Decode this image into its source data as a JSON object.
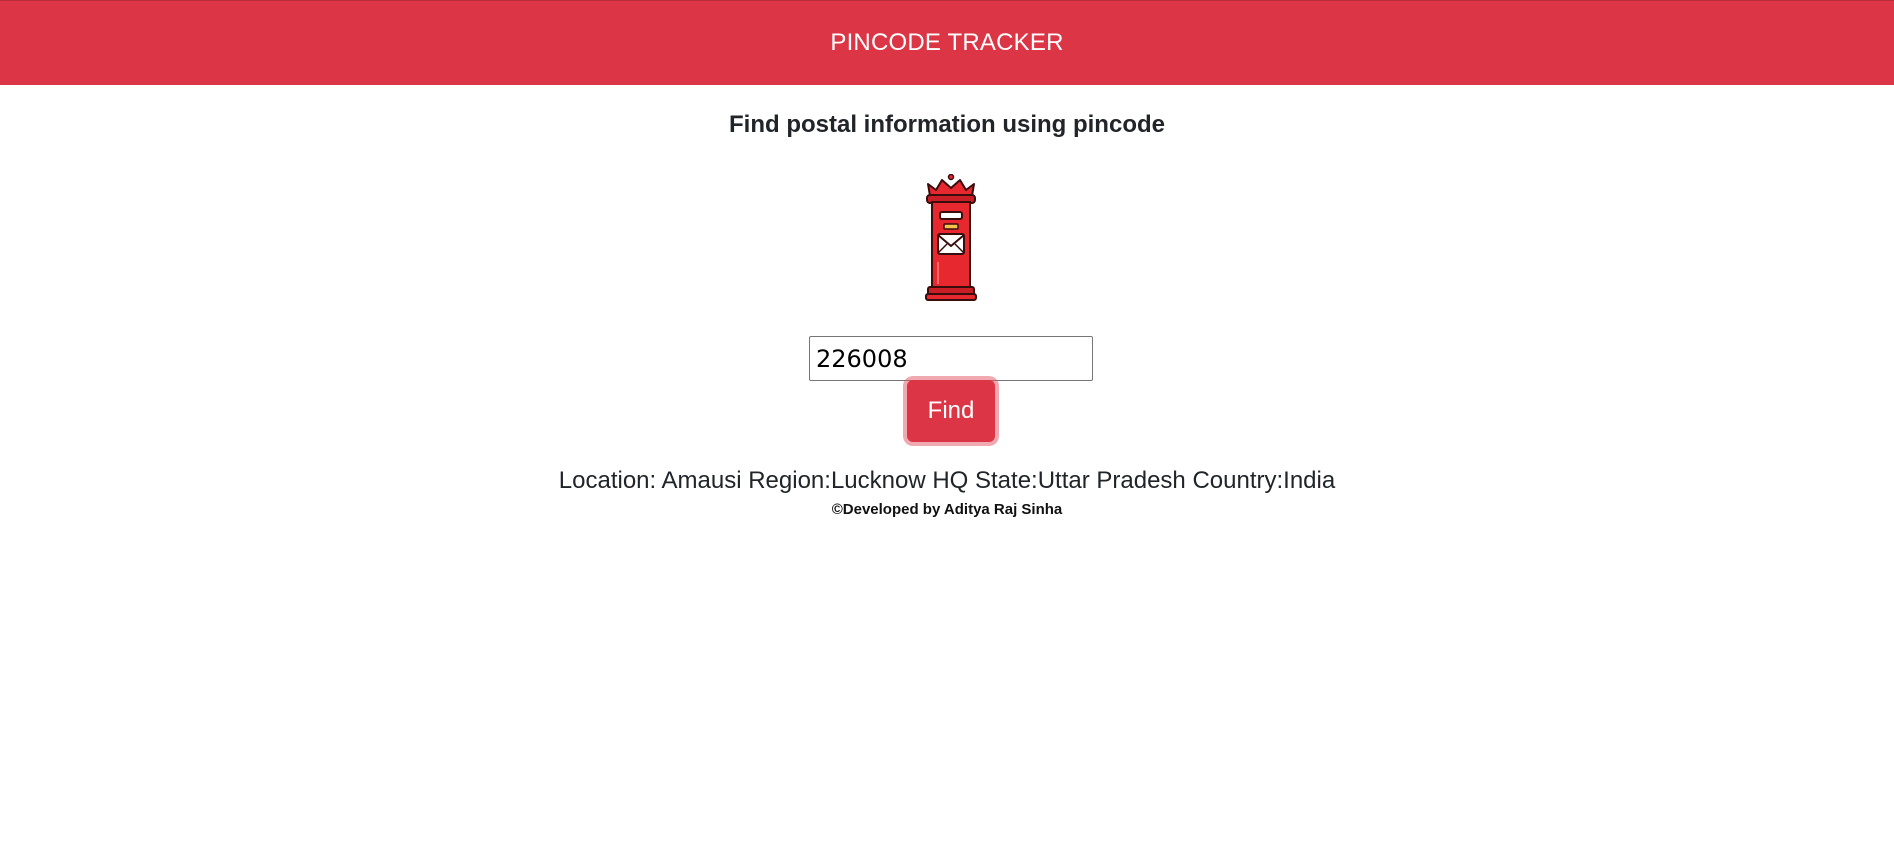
{
  "header": {
    "title": "PINCODE TRACKER",
    "color": "#dc3545"
  },
  "main": {
    "heading": "Find postal information using pincode",
    "icon": "postbox-icon",
    "input_value": "226008",
    "find_label": "Find",
    "result": "Location: Amausi Region:Lucknow HQ State:Uttar Pradesh Country:India"
  },
  "footer": {
    "credit": "©Developed by Aditya Raj Sinha"
  }
}
